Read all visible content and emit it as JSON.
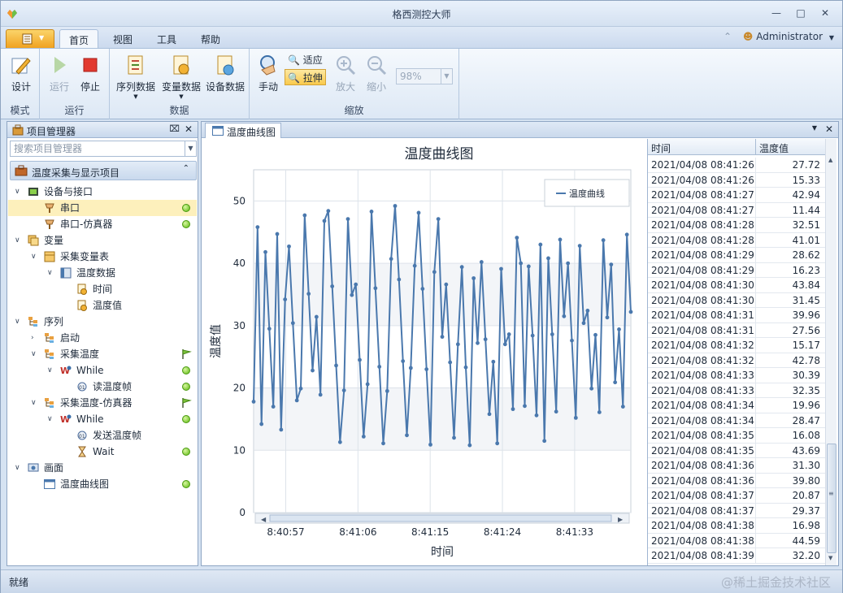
{
  "window": {
    "title": "格西测控大师"
  },
  "menu": {
    "tabs": [
      "首页",
      "视图",
      "工具",
      "帮助"
    ],
    "user": "Administrator"
  },
  "ribbon": {
    "groups": [
      "模式",
      "运行",
      "数据",
      "缩放"
    ],
    "design": "设计",
    "run": "运行",
    "stop": "停止",
    "seq_data": "序列数据",
    "var_data": "变量数据",
    "dev_data": "设备数据",
    "manual": "手动",
    "fit": "适应",
    "stretch": "拉伸",
    "zoom_in": "放大",
    "zoom_out": "缩小",
    "zoom_value": "98%"
  },
  "project": {
    "panel_title": "项目管理器",
    "search_placeholder": "搜索项目管理器",
    "section_title": "温度采集与显示项目",
    "tree": [
      {
        "label": "设备与接口",
        "level": 0,
        "expanded": true,
        "icon": "device-icon"
      },
      {
        "label": "串口",
        "level": 1,
        "icon": "serial-port-icon",
        "status": "ok",
        "selected": true
      },
      {
        "label": "串口-仿真器",
        "level": 1,
        "icon": "serial-port-icon",
        "status": "ok"
      },
      {
        "label": "变量",
        "level": 0,
        "expanded": true,
        "icon": "variables-icon"
      },
      {
        "label": "采集变量表",
        "level": 1,
        "expanded": true,
        "icon": "table-icon"
      },
      {
        "label": "温度数据",
        "level": 2,
        "expanded": true,
        "icon": "dataset-icon"
      },
      {
        "label": "时间",
        "level": 3,
        "icon": "variable-icon"
      },
      {
        "label": "温度值",
        "level": 3,
        "icon": "variable-icon"
      },
      {
        "label": "序列",
        "level": 0,
        "expanded": true,
        "icon": "sequence-icon"
      },
      {
        "label": "启动",
        "level": 1,
        "expanded": false,
        "icon": "sequence-icon"
      },
      {
        "label": "采集温度",
        "level": 1,
        "expanded": true,
        "icon": "sequence-icon",
        "flag": true
      },
      {
        "label": "While",
        "level": 2,
        "expanded": true,
        "icon": "while-icon",
        "status": "ok"
      },
      {
        "label": "读温度帧",
        "level": 3,
        "icon": "frame-icon",
        "status": "ok"
      },
      {
        "label": "采集温度-仿真器",
        "level": 1,
        "expanded": true,
        "icon": "sequence-icon",
        "flag": true
      },
      {
        "label": "While",
        "level": 2,
        "expanded": true,
        "icon": "while-icon",
        "status": "ok"
      },
      {
        "label": "发送温度帧",
        "level": 3,
        "icon": "frame-icon"
      },
      {
        "label": "Wait",
        "level": 3,
        "icon": "hourglass-icon",
        "status": "ok"
      },
      {
        "label": "画面",
        "level": 0,
        "expanded": true,
        "icon": "screen-icon"
      },
      {
        "label": "温度曲线图",
        "level": 1,
        "icon": "chart-window-icon",
        "status": "ok"
      }
    ]
  },
  "doc": {
    "tab": "温度曲线图"
  },
  "chart_data": {
    "type": "line",
    "title": "温度曲线图",
    "xlabel": "时间",
    "ylabel": "温度值",
    "legend": [
      "温度曲线"
    ],
    "legend_position": "top-right",
    "ylim": [
      0,
      55
    ],
    "yticks": [
      0,
      10,
      20,
      30,
      40,
      50
    ],
    "xticks": [
      "8:40:57",
      "8:41:06",
      "8:41:15",
      "8:41:24",
      "8:41:33"
    ],
    "xtick_positions": [
      4,
      13,
      22,
      31,
      40
    ],
    "xlim": [
      0,
      47
    ],
    "series": [
      {
        "name": "温度曲线",
        "values": [
          17.8,
          45.8,
          14.2,
          41.8,
          29.5,
          17.0,
          44.7,
          13.3,
          34.2,
          42.7,
          30.4,
          18.0,
          19.9,
          47.7,
          35.1,
          22.8,
          31.4,
          18.9,
          46.8,
          48.4,
          36.3,
          23.6,
          11.3,
          19.6,
          47.1,
          34.9,
          36.6,
          24.5,
          12.2,
          20.6,
          48.3,
          36.0,
          23.4,
          11.1,
          19.5,
          40.7,
          49.2,
          37.4,
          24.3,
          12.4,
          23.2,
          39.6,
          48.1,
          35.9,
          23.0,
          10.9,
          38.6,
          47.1,
          28.2,
          36.6,
          24.1,
          12.0,
          27.0,
          39.4,
          23.3,
          10.8,
          37.6,
          27.2,
          40.2,
          27.8,
          15.8,
          24.2,
          11.1,
          39.1,
          27.0,
          28.6,
          16.6,
          44.1,
          40.0,
          17.1,
          39.5,
          28.4,
          15.6,
          43.0,
          11.5,
          40.8,
          28.6,
          16.2,
          43.8,
          31.5,
          40.0,
          27.6,
          15.2,
          42.8,
          30.4,
          32.4,
          19.9,
          28.5,
          16.1,
          43.7,
          31.3,
          39.8,
          20.9,
          29.4,
          17.0,
          44.6,
          32.2
        ]
      }
    ]
  },
  "table": {
    "headers": [
      "时间",
      "温度值"
    ],
    "rows": [
      [
        "2021/04/08 08:41:26",
        "27.72"
      ],
      [
        "2021/04/08 08:41:26",
        "15.33"
      ],
      [
        "2021/04/08 08:41:27",
        "42.94"
      ],
      [
        "2021/04/08 08:41:27",
        "11.44"
      ],
      [
        "2021/04/08 08:41:28",
        "32.51"
      ],
      [
        "2021/04/08 08:41:28",
        "41.01"
      ],
      [
        "2021/04/08 08:41:29",
        "28.62"
      ],
      [
        "2021/04/08 08:41:29",
        "16.23"
      ],
      [
        "2021/04/08 08:41:30",
        "43.84"
      ],
      [
        "2021/04/08 08:41:30",
        "31.45"
      ],
      [
        "2021/04/08 08:41:31",
        "39.96"
      ],
      [
        "2021/04/08 08:41:31",
        "27.56"
      ],
      [
        "2021/04/08 08:41:32",
        "15.17"
      ],
      [
        "2021/04/08 08:41:32",
        "42.78"
      ],
      [
        "2021/04/08 08:41:33",
        "30.39"
      ],
      [
        "2021/04/08 08:41:33",
        "32.35"
      ],
      [
        "2021/04/08 08:41:34",
        "19.96"
      ],
      [
        "2021/04/08 08:41:34",
        "28.47"
      ],
      [
        "2021/04/08 08:41:35",
        "16.08"
      ],
      [
        "2021/04/08 08:41:35",
        "43.69"
      ],
      [
        "2021/04/08 08:41:36",
        "31.30"
      ],
      [
        "2021/04/08 08:41:36",
        "39.80"
      ],
      [
        "2021/04/08 08:41:37",
        "20.87"
      ],
      [
        "2021/04/08 08:41:37",
        "29.37"
      ],
      [
        "2021/04/08 08:41:38",
        "16.98"
      ],
      [
        "2021/04/08 08:41:38",
        "44.59"
      ],
      [
        "2021/04/08 08:41:39",
        "32.20"
      ]
    ]
  },
  "status": {
    "text": "就绪",
    "watermark": "@稀土掘金技术社区"
  },
  "colors": {
    "accent": "#f5b335",
    "line": "#4a78ad",
    "ok": "#5db80f"
  }
}
